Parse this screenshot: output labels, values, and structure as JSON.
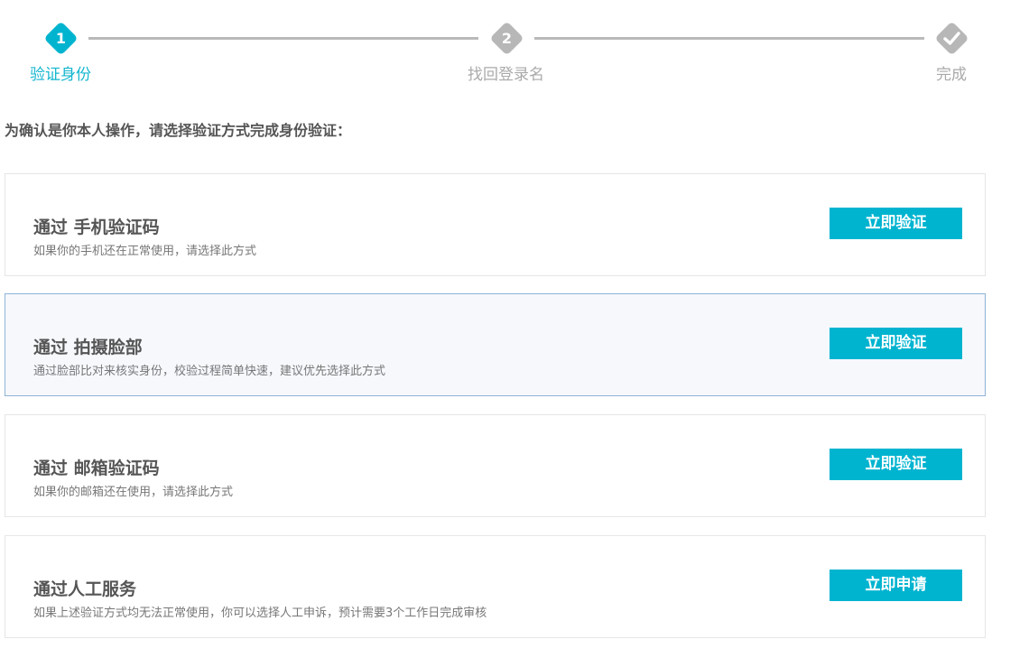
{
  "colors": {
    "accent": "#00b4d0",
    "inactive": "#b7b7b7",
    "highlight_bg": "#f6f8fc",
    "highlight_border": "#8fb3d6"
  },
  "stepper": {
    "steps": [
      {
        "number": "1",
        "label": "验证身份",
        "state": "active",
        "icon": "number"
      },
      {
        "number": "2",
        "label": "找回登录名",
        "state": "inactive",
        "icon": "number"
      },
      {
        "number": "",
        "label": "完成",
        "state": "inactive",
        "icon": "checkmark-icon"
      }
    ]
  },
  "intro": "为确认是你本人操作，请选择验证方式完成身份验证：",
  "methods": [
    {
      "title": "通过 手机验证码",
      "desc": "如果你的手机还在正常使用，请选择此方式",
      "button": "立即验证"
    },
    {
      "title": "通过 拍摄脸部",
      "desc": "通过脸部比对来核实身份，校验过程简单快速，建议优先选择此方式",
      "button": "立即验证"
    },
    {
      "title": "通过 邮箱验证码",
      "desc": "如果你的邮箱还在使用，请选择此方式",
      "button": "立即验证"
    },
    {
      "title": "通过人工服务",
      "desc": "如果上述验证方式均无法正常使用，你可以选择人工申诉，预计需要3个工作日完成审核",
      "button": "立即申请"
    }
  ]
}
